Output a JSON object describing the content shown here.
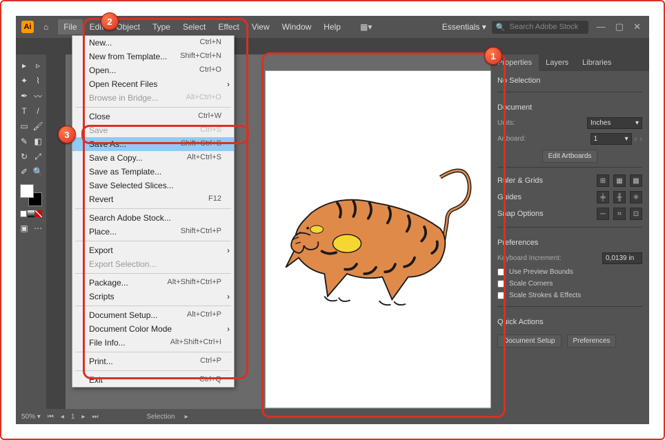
{
  "menubar": [
    "File",
    "Edit",
    "Object",
    "Type",
    "Select",
    "Effect",
    "View",
    "Window",
    "Help"
  ],
  "workspace": "Essentials",
  "search_placeholder": "Search Adobe Stock",
  "file_menu": [
    {
      "label": "New...",
      "sc": "Ctrl+N"
    },
    {
      "label": "New from Template...",
      "sc": "Shift+Ctrl+N"
    },
    {
      "label": "Open...",
      "sc": "Ctrl+O"
    },
    {
      "label": "Open Recent Files",
      "sub": true
    },
    {
      "label": "Browse in Bridge...",
      "sc": "Alt+Ctrl+O",
      "disabled": true
    },
    {
      "sep": true
    },
    {
      "label": "Close",
      "sc": "Ctrl+W"
    },
    {
      "label": "Save",
      "sc": "Ctrl+S",
      "disabled": true
    },
    {
      "label": "Save As...",
      "sc": "Shift+Ctrl+S",
      "hl": true
    },
    {
      "label": "Save a Copy...",
      "sc": "Alt+Ctrl+S"
    },
    {
      "label": "Save as Template..."
    },
    {
      "label": "Save Selected Slices..."
    },
    {
      "label": "Revert",
      "sc": "F12"
    },
    {
      "sep": true
    },
    {
      "label": "Search Adobe Stock..."
    },
    {
      "label": "Place...",
      "sc": "Shift+Ctrl+P"
    },
    {
      "sep": true
    },
    {
      "label": "Export",
      "sub": true
    },
    {
      "label": "Export Selection...",
      "disabled": true
    },
    {
      "sep": true
    },
    {
      "label": "Package...",
      "sc": "Alt+Shift+Ctrl+P"
    },
    {
      "label": "Scripts",
      "sub": true
    },
    {
      "sep": true
    },
    {
      "label": "Document Setup...",
      "sc": "Alt+Ctrl+P"
    },
    {
      "label": "Document Color Mode",
      "sub": true
    },
    {
      "label": "File Info...",
      "sc": "Alt+Shift+Ctrl+I"
    },
    {
      "sep": true
    },
    {
      "label": "Print...",
      "sc": "Ctrl+P"
    },
    {
      "sep": true
    },
    {
      "label": "Exit",
      "sc": "Ctrl+Q"
    }
  ],
  "zoom": "50%",
  "page": "1",
  "status": "Selection",
  "panel": {
    "tabs": [
      "Properties",
      "Layers",
      "Libraries"
    ],
    "no_selection": "No Selection",
    "document": "Document",
    "units_label": "Units:",
    "units_value": "Inches",
    "artboard_label": "Artboard:",
    "artboard_value": "1",
    "edit_artboards": "Edit Artboards",
    "ruler": "Ruler & Grids",
    "guides": "Guides",
    "snap": "Snap Options",
    "prefs": "Preferences",
    "ki_label": "Keyboard Increment:",
    "ki_value": "0,0139 in",
    "cb1": "Use Preview Bounds",
    "cb2": "Scale Corners",
    "cb3": "Scale Strokes & Effects",
    "qa": "Quick Actions",
    "qa1": "Document Setup",
    "qa2": "Preferences"
  },
  "badges": {
    "b1": "1",
    "b2": "2",
    "b3": "3"
  }
}
